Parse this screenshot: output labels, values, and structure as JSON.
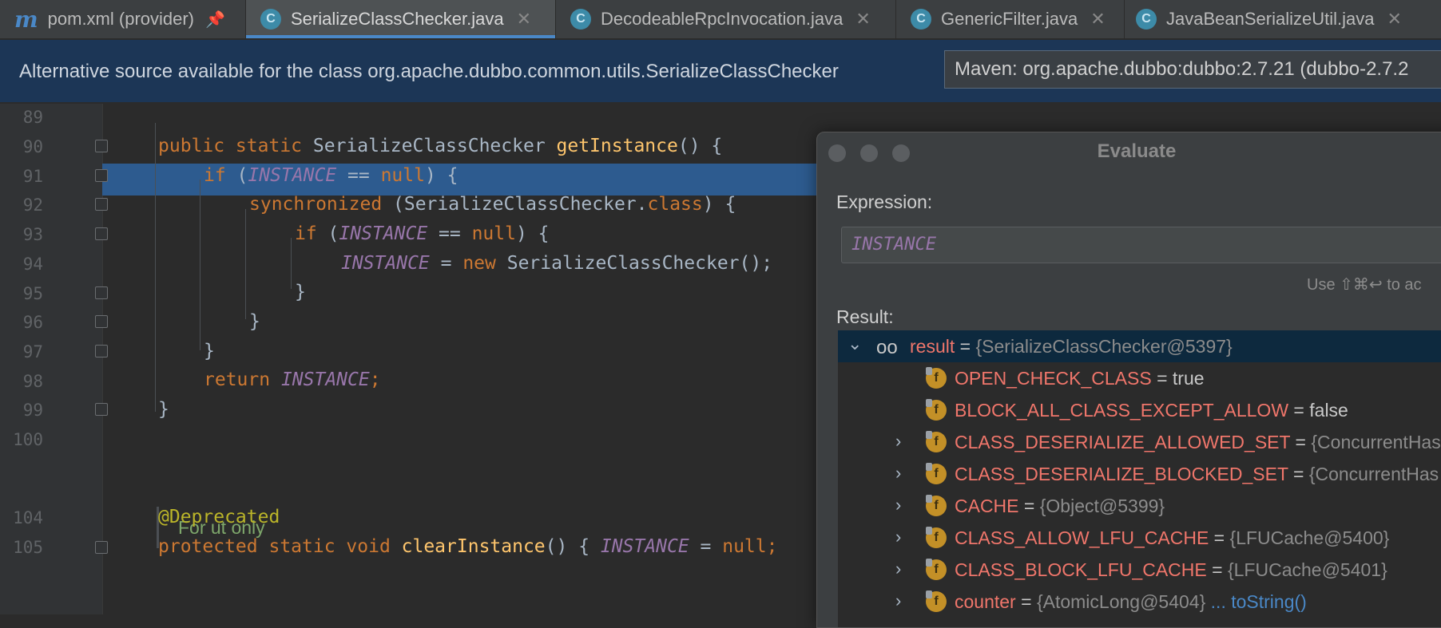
{
  "tabs": [
    {
      "label": "pom.xml (provider)",
      "icon": "maven-m-icon",
      "pinned": true
    },
    {
      "label": "SerializeClassChecker.java",
      "icon": "class-c-icon",
      "active": true
    },
    {
      "label": "DecodeableRpcInvocation.java",
      "icon": "class-c-icon"
    },
    {
      "label": "GenericFilter.java",
      "icon": "class-c-icon"
    },
    {
      "label": "JavaBeanSerializeUtil.java",
      "icon": "class-c-icon"
    }
  ],
  "banner": {
    "text": "Alternative source available for the class org.apache.dubbo.common.utils.SerializeClassChecker",
    "select_value": "Maven: org.apache.dubbo:dubbo:2.7.21 (dubbo-2.7.2"
  },
  "editor": {
    "line_numbers": [
      "89",
      "90",
      "91",
      "92",
      "93",
      "94",
      "95",
      "96",
      "97",
      "98",
      "99",
      "100",
      "104",
      "105"
    ],
    "doc_comment": "For ut only",
    "code_lines": {
      "l90": [
        "public static ",
        "SerializeClassChecker ",
        "getInstance",
        "() {"
      ],
      "l91": [
        "if ",
        "(",
        "INSTANCE",
        " == ",
        "null",
        ") {"
      ],
      "l92": [
        "synchronized ",
        "(SerializeClassChecker.",
        "class",
        ") {"
      ],
      "l93": [
        "if ",
        "(",
        "INSTANCE",
        " == ",
        "null",
        ") {"
      ],
      "l94": [
        "INSTANCE",
        " = ",
        "new ",
        "SerializeClassChecker();"
      ],
      "l95": "}",
      "l96": "}",
      "l97": "}",
      "l98": [
        "return ",
        "INSTANCE",
        ";"
      ],
      "l99": "}",
      "l104": "@Deprecated",
      "l105": [
        "protected static void ",
        "clearInstance",
        "() { ",
        "INSTANCE",
        " = ",
        "null",
        ";"
      ]
    }
  },
  "evaluate": {
    "title": "Evaluate",
    "expression_label": "Expression:",
    "expression_value": "INSTANCE",
    "hint": "Use ⇧⌘↩ to ac",
    "result_label": "Result:",
    "result_root": {
      "name": "result",
      "eq": " = ",
      "value": "{SerializeClassChecker@5397}"
    },
    "fields": [
      {
        "name": "OPEN_CHECK_CLASS",
        "value": "true",
        "expandable": false
      },
      {
        "name": "BLOCK_ALL_CLASS_EXCEPT_ALLOW",
        "value": "false",
        "expandable": false
      },
      {
        "name": "CLASS_DESERIALIZE_ALLOWED_SET",
        "value": "{ConcurrentHas",
        "expandable": true
      },
      {
        "name": "CLASS_DESERIALIZE_BLOCKED_SET",
        "value": "{ConcurrentHas",
        "expandable": true
      },
      {
        "name": "CACHE",
        "value": "{Object@5399}",
        "expandable": true
      },
      {
        "name": "CLASS_ALLOW_LFU_CACHE",
        "value": "{LFUCache@5400}",
        "expandable": true
      },
      {
        "name": "CLASS_BLOCK_LFU_CACHE",
        "value": "{LFUCache@5401}",
        "expandable": true
      },
      {
        "name": "counter",
        "value": "{AtomicLong@5404}",
        "expandable": true,
        "link": "... toString()"
      }
    ]
  },
  "colors": {
    "keyword": "#cc7832",
    "method": "#ffc66d",
    "static_field": "#9876aa",
    "field_name": "#f0766b",
    "highlight": "#2d5b8f",
    "banner": "#1c3656"
  }
}
